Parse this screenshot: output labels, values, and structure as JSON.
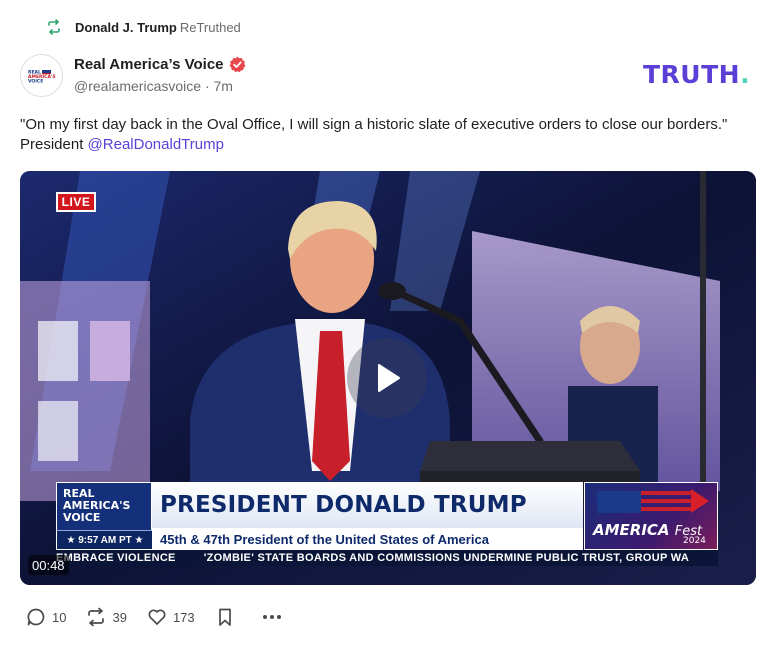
{
  "retruth": {
    "name": "Donald J. Trump",
    "label": "ReTruthed"
  },
  "author": {
    "display_name": "Real America’s Voice",
    "handle": "@realamericasvoice",
    "separator": "·",
    "time": "7m",
    "avatar_text_line1": "REAL",
    "avatar_text_line2": "AMERICA'S",
    "avatar_text_line3": "VOICE"
  },
  "brand": {
    "logo_text": "TRUTH",
    "logo_dot": "."
  },
  "post": {
    "text": "\"On my first day back in the Oval Office, I will sign a historic slate of executive orders to close our borders.\" President ",
    "mention": "@RealDonaldTrump"
  },
  "video": {
    "live_label": "LIVE",
    "duration": "00:48",
    "lower_third": {
      "brand_line1": "REAL",
      "brand_line2": "AMERICA'S",
      "brand_line3": "VOICE",
      "time": "9:57 AM PT",
      "title": "PRESIDENT DONALD TRUMP",
      "subtitle": "45th & 47th President of the United States of America",
      "promo_text": "AMERICA",
      "promo_script": "Fest",
      "promo_year": "2024"
    },
    "ticker": [
      "EMBRACE VIOLENCE",
      "'ZOMBIE' STATE BOARDS AND COMMISSIONS UNDERMINE PUBLIC TRUST, GROUP WA"
    ]
  },
  "actions": {
    "replies": "10",
    "retruths": "39",
    "likes": "173"
  },
  "icons": {
    "retruth": "retruth-icon",
    "verified": "verified-badge-icon",
    "play": "play-icon",
    "reply": "reply-icon",
    "like": "heart-icon",
    "bookmark": "bookmark-icon",
    "more": "more-dots-icon"
  },
  "colors": {
    "accent": "#5b3fd6",
    "retruth_green": "#2fa56e",
    "verified_red": "#e8474b",
    "live_red": "#d3161c",
    "broadcast_blue": "#0e2a6b"
  }
}
